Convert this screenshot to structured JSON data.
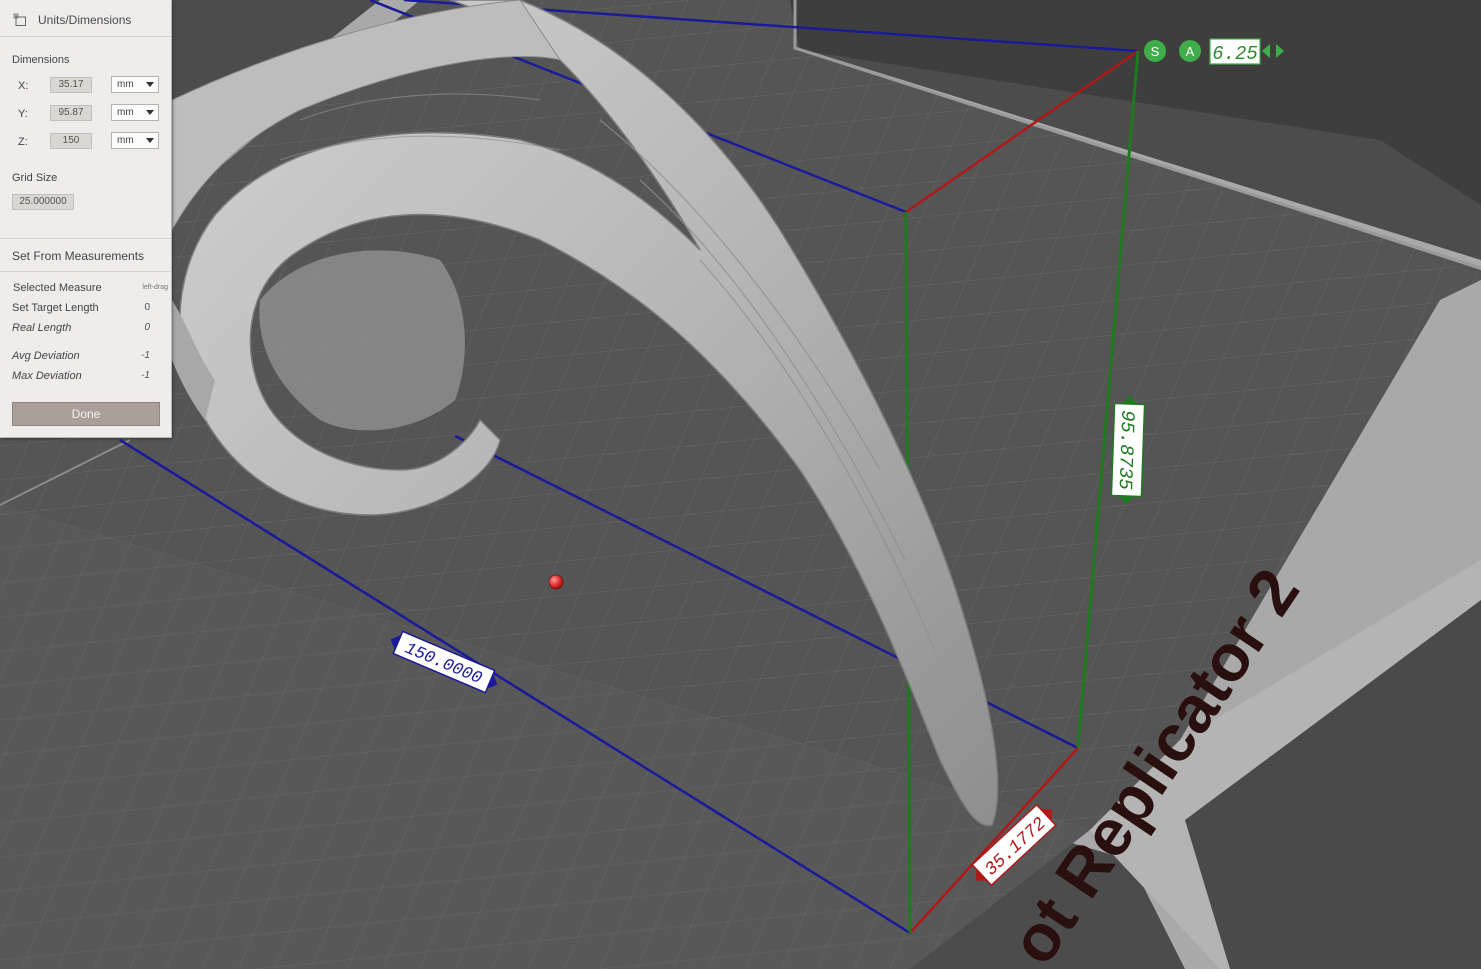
{
  "panel": {
    "title": "Units/Dimensions",
    "dimensions_label": "Dimensions",
    "x": {
      "label": "X:",
      "value": "35.17",
      "unit": "mm"
    },
    "y": {
      "label": "Y:",
      "value": "95.87",
      "unit": "mm"
    },
    "z": {
      "label": "Z:",
      "value": "150",
      "unit": "mm"
    },
    "grid_size_label": "Grid Size",
    "grid_size_value": "25.000000",
    "set_from_label": "Set From Measurements",
    "selected_measure_label": "Selected Measure",
    "selected_measure_hint": "left-drag",
    "set_target_length_label": "Set Target Length",
    "set_target_length_value": "0",
    "real_length_label": "Real Length",
    "real_length_value": "0",
    "avg_deviation_label": "Avg Deviation",
    "avg_deviation_value": "-1",
    "max_deviation_label": "Max Deviation",
    "max_deviation_value": "-1",
    "done_label": "Done"
  },
  "viewport": {
    "s_button": "S",
    "a_button": "A",
    "size_value": "6.25",
    "dim_x_label": "35.1772",
    "dim_y_label": "95.8735",
    "dim_z_label": "150.0000",
    "bed_label": "ot Replicator 2"
  },
  "colors": {
    "x_axis": "#b01818",
    "y_axis": "#1e7a1e",
    "z_axis": "#1a1a9a",
    "handle_green": "#3fae4a",
    "panel_bg": "#efedeb",
    "done_bg": "#ab9f99"
  }
}
